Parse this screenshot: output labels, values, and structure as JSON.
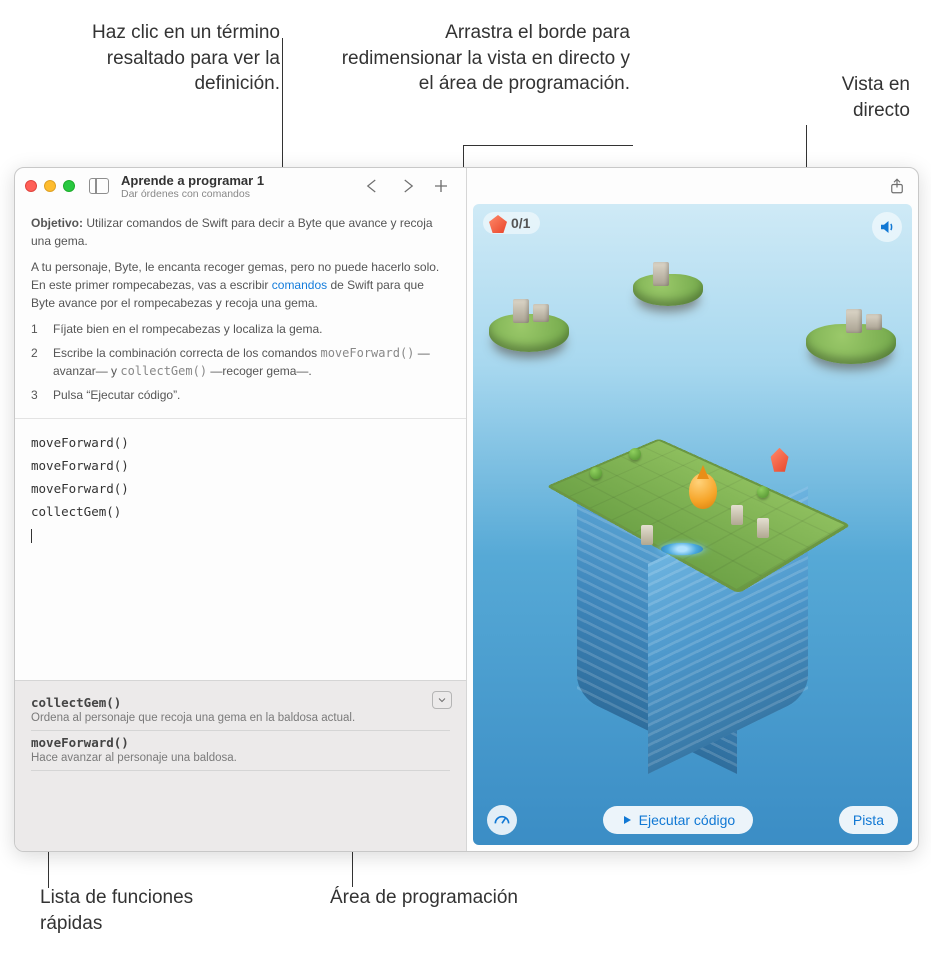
{
  "annotations": {
    "highlight_term": "Haz clic en un término resaltado para ver la definición.",
    "drag_edge": "Arrastra el borde para redimensionar la vista en directo y el área de programación.",
    "live_view": "Vista en directo",
    "quick_funcs": "Lista de funciones rápidas",
    "code_area": "Área de programación"
  },
  "titlebar": {
    "title": "Aprende a programar 1",
    "subtitle": "Dar órdenes con comandos"
  },
  "instructions": {
    "objective_label": "Objetivo:",
    "objective_text": "Utilizar comandos de Swift para decir a Byte que avance y recoja una gema.",
    "intro_1": "A tu personaje, Byte, le encanta recoger gemas, pero no puede hacerlo solo. En este primer rompecabezas, vas a escribir ",
    "intro_link": "comandos",
    "intro_2": " de Swift para que Byte avance por el rompecabezas y recoja una gema.",
    "steps": [
      "Fíjate bien en el rompecabezas y localiza la gema.",
      "Escribe la combinación correcta de los comandos ",
      "Pulsa “Ejecutar código”."
    ],
    "step2_code1": "moveForward()",
    "step2_mid": " —avanzar— y ",
    "step2_code2": "collectGem()",
    "step2_end": " —recoger gema—."
  },
  "code_lines": [
    "moveForward()",
    "moveForward()",
    "moveForward()",
    "collectGem()"
  ],
  "quick_functions": {
    "items": [
      {
        "name": "collectGem()",
        "desc": "Ordena al personaje que recoja una gema en la baldosa actual."
      },
      {
        "name": "moveForward()",
        "desc": "Hace avanzar al personaje una baldosa."
      }
    ]
  },
  "live": {
    "gem_counter": "0/1",
    "run_label": "Ejecutar código",
    "hint_label": "Pista"
  }
}
